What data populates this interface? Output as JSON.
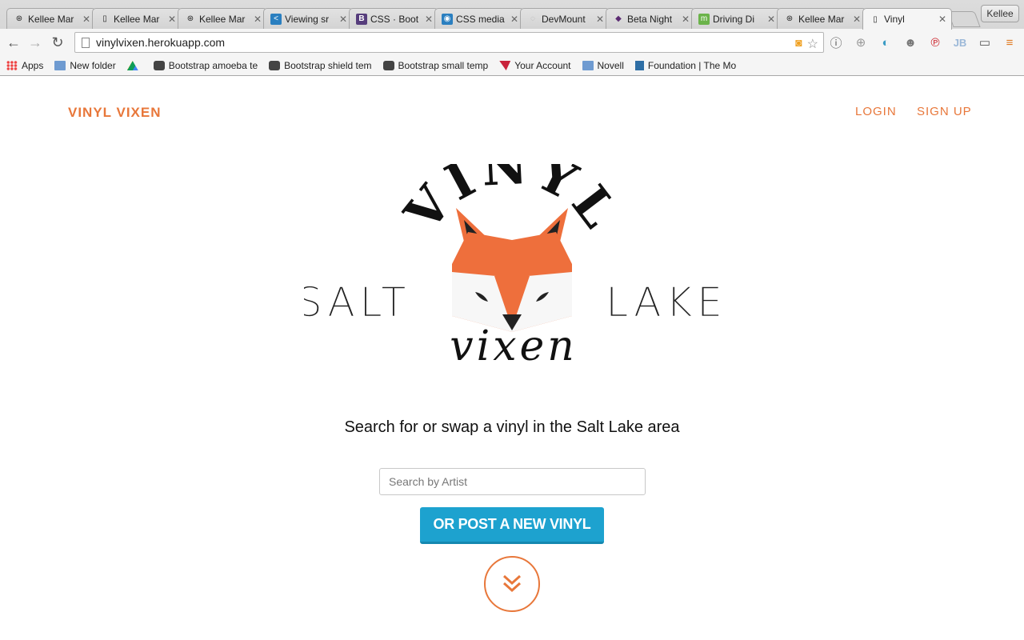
{
  "browser": {
    "tabs": [
      {
        "title": "Kellee Mar",
        "icon": "octocat-icon"
      },
      {
        "title": "Kellee Mar",
        "icon": "page-icon"
      },
      {
        "title": "Kellee Mar",
        "icon": "octocat-icon"
      },
      {
        "title": "Viewing sr",
        "icon": "code-icon"
      },
      {
        "title": "CSS · Boot",
        "icon": "bootstrap-icon"
      },
      {
        "title": "CSS media",
        "icon": "chat-icon"
      },
      {
        "title": "DevMount",
        "icon": "globe-icon"
      },
      {
        "title": "Beta Night",
        "icon": "diamond-icon"
      },
      {
        "title": "Driving Di",
        "icon": "map-icon"
      },
      {
        "title": "Kellee Mar",
        "icon": "octocat-icon"
      },
      {
        "title": "Vinyl",
        "icon": "page-icon"
      }
    ],
    "profile_name": "Kellee",
    "url": "vinylvixen.herokuapp.com",
    "bookmarks": [
      {
        "label": "Apps",
        "icon": "apps-grid-icon"
      },
      {
        "label": "New folder",
        "icon": "folder-icon"
      },
      {
        "label": "",
        "icon": "drive-icon"
      },
      {
        "label": "Bootstrap amoeba te",
        "icon": "hexagon-icon"
      },
      {
        "label": "Bootstrap shield tem",
        "icon": "hexagon-icon"
      },
      {
        "label": "Bootstrap small temp",
        "icon": "hexagon-icon"
      },
      {
        "label": "Your Account",
        "icon": "flag-icon"
      },
      {
        "label": "Novell",
        "icon": "folder-icon"
      },
      {
        "label": "Foundation | The Mo",
        "icon": "foundation-icon"
      }
    ]
  },
  "site": {
    "brand": "VINYL VIXEN",
    "nav": {
      "login": "LOGIN",
      "signup": "SIGN UP"
    },
    "logo": {
      "arc_text": "VINYL",
      "left_text": "SALT",
      "right_text": "LAKE",
      "script_text": "vixen"
    },
    "tagline": "Search for or swap a vinyl in the Salt Lake area",
    "search_placeholder": "Search by Artist",
    "post_button": "OR POST A NEW VINYL",
    "accent_color": "#e8773a",
    "button_color": "#1da2cf"
  }
}
